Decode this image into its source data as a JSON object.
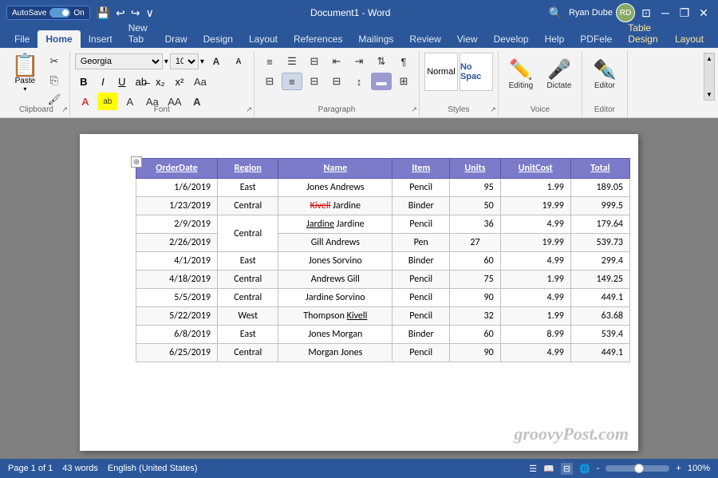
{
  "titleBar": {
    "autosave": "AutoSave",
    "autosaveState": "On",
    "title": "Document1 - Word",
    "user": "Ryan Dube",
    "buttons": {
      "minimize": "─",
      "restore": "❐",
      "close": "✕"
    }
  },
  "ribbonTabs": [
    {
      "label": "File",
      "active": false
    },
    {
      "label": "Home",
      "active": true
    },
    {
      "label": "Insert",
      "active": false
    },
    {
      "label": "New Tab",
      "active": false
    },
    {
      "label": "Draw",
      "active": false
    },
    {
      "label": "Design",
      "active": false
    },
    {
      "label": "Layout",
      "active": false
    },
    {
      "label": "References",
      "active": false
    },
    {
      "label": "Mailings",
      "active": false
    },
    {
      "label": "Review",
      "active": false
    },
    {
      "label": "View",
      "active": false
    },
    {
      "label": "Develop",
      "active": false
    },
    {
      "label": "Help",
      "active": false
    },
    {
      "label": "PDFele",
      "active": false
    },
    {
      "label": "Table Design",
      "active": false,
      "contextual": true
    },
    {
      "label": "Layout",
      "active": false,
      "contextual": true
    }
  ],
  "ribbon": {
    "groups": {
      "clipboard": {
        "label": "Clipboard",
        "pasteLabel": "Paste"
      },
      "font": {
        "label": "Font",
        "fontName": "Georgia",
        "fontSize": "10",
        "bold": "B",
        "italic": "I",
        "underline": "U"
      },
      "paragraph": {
        "label": "Paragraph"
      },
      "styles": {
        "label": "Styles"
      },
      "voice": {
        "label": "Voice",
        "editingLabel": "Editing",
        "dictateLabel": "Dictate"
      },
      "editor": {
        "label": "Editor",
        "editorLabel": "Editor"
      }
    }
  },
  "toolbar": {
    "searchPlaceholder": "Search"
  },
  "table": {
    "headers": [
      "OrderDate",
      "Region",
      "Name",
      "Item",
      "Units",
      "UnitCost",
      "Total"
    ],
    "rows": [
      {
        "date": "1/6/2019",
        "region": "East",
        "name": "Jones Andrews",
        "item": "Pencil",
        "units": "95",
        "unitcost": "1.99",
        "total": "189.05"
      },
      {
        "date": "1/23/2019",
        "region": "Central",
        "name_strike": "Kivell",
        "name_rest": " Jardine",
        "item": "Binder",
        "units": "50",
        "unitcost": "19.99",
        "total": "999.5"
      },
      {
        "date": "2/9/2019",
        "region": "Central",
        "name_underline": "Jardine",
        "name_rest": " Jardine",
        "item": "Pencil",
        "units": "36",
        "unitcost": "4.99",
        "total": "179.64"
      },
      {
        "date": "2/26/2019",
        "region": "",
        "name": "Gill Andrews",
        "item": "Pen",
        "units": "27",
        "unitcost": "19.99",
        "total": "539.73"
      },
      {
        "date": "4/1/2019",
        "region": "East",
        "name": "Jones Sorvino",
        "item": "Binder",
        "units": "60",
        "unitcost": "4.99",
        "total": "299.4"
      },
      {
        "date": "4/18/2019",
        "region": "Central",
        "name": "Andrews Gill",
        "item": "Pencil",
        "units": "75",
        "unitcost": "1.99",
        "total": "149.25"
      },
      {
        "date": "5/5/2019",
        "region": "Central",
        "name": "Jardine Sorvino",
        "item": "Pencil",
        "units": "90",
        "unitcost": "4.99",
        "total": "449.1"
      },
      {
        "date": "5/22/2019",
        "region": "West",
        "name_rest": "Thompson ",
        "name_underline": "Kivell",
        "item": "Pencil",
        "units": "32",
        "unitcost": "1.99",
        "total": "63.68"
      },
      {
        "date": "6/8/2019",
        "region": "East",
        "name": "Jones Morgan",
        "item": "Binder",
        "units": "60",
        "unitcost": "8.99",
        "total": "539.4"
      },
      {
        "date": "6/25/2019",
        "region": "Central",
        "name": "Morgan Jones",
        "item": "Pencil",
        "units": "90",
        "unitcost": "4.99",
        "total": "449.1"
      }
    ]
  },
  "watermark": "groovyPost.com",
  "statusBar": {
    "page": "Page 1 of 1",
    "words": "43 words",
    "language": "English (United States)"
  }
}
